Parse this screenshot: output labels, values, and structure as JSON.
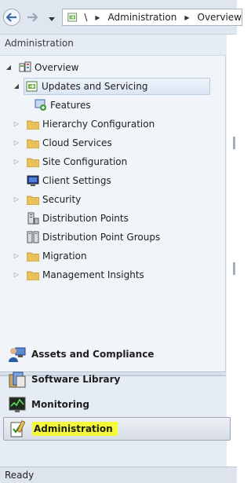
{
  "address_bar": {
    "root_symbol": "\\",
    "crumbs": [
      "Administration",
      "Overview"
    ]
  },
  "pane": {
    "header": "Administration"
  },
  "tree": {
    "overview": "Overview",
    "updates_and_servicing": "Updates and Servicing",
    "features": "Features",
    "hierarchy_configuration": "Hierarchy Configuration",
    "cloud_services": "Cloud Services",
    "site_configuration": "Site Configuration",
    "client_settings": "Client Settings",
    "security": "Security",
    "distribution_points": "Distribution Points",
    "distribution_point_groups": "Distribution Point Groups",
    "migration": "Migration",
    "management_insights": "Management Insights"
  },
  "workspaces": {
    "assets": "Assets and Compliance",
    "software": "Software Library",
    "monitoring": "Monitoring",
    "administration": "Administration"
  },
  "status": {
    "text": "Ready"
  },
  "colors": {
    "highlight": "#f4f93a",
    "selection": "#dbe6f4",
    "folder": "#e8c15a"
  },
  "icons": {
    "back": "arrow-left-icon",
    "forward": "arrow-right-icon",
    "folder": "folder-icon",
    "console": "console-home-icon"
  }
}
